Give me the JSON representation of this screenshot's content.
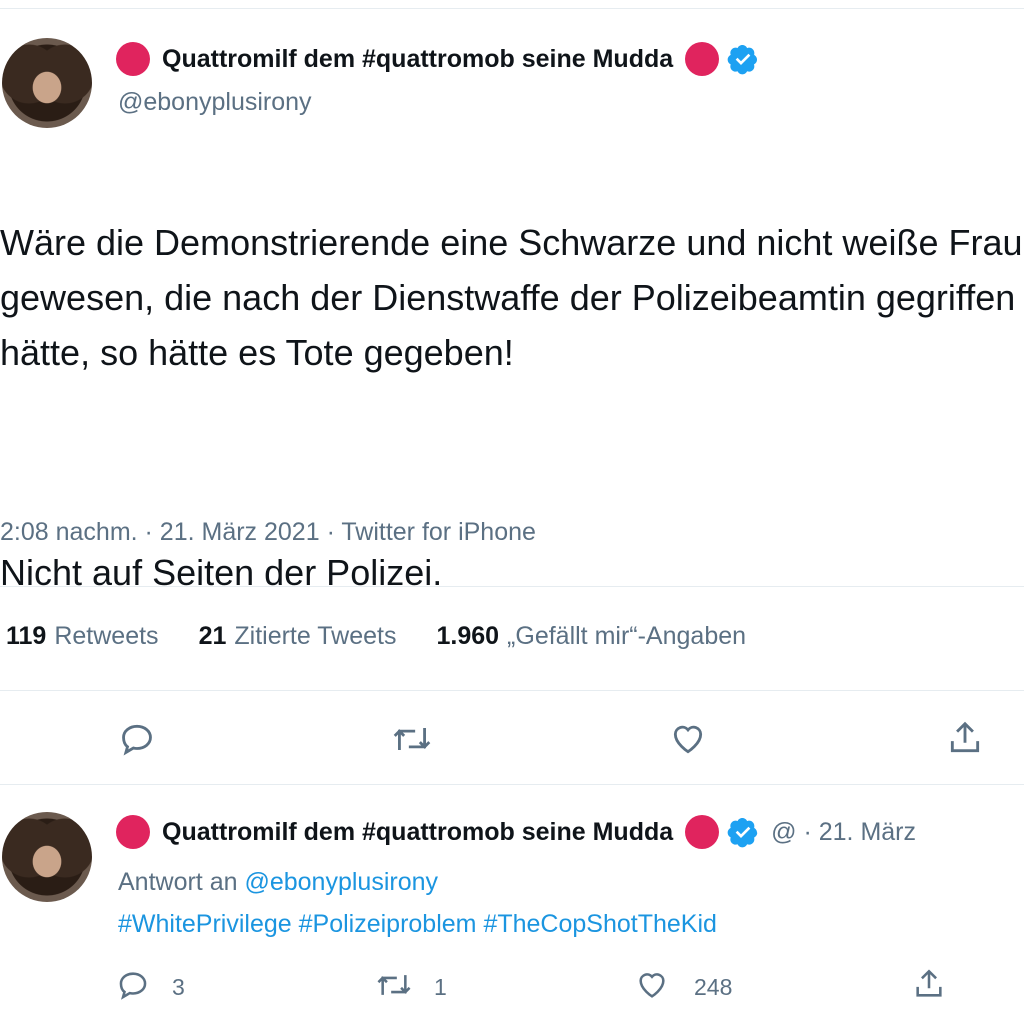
{
  "main_tweet": {
    "display_name": "Quattromilf dem #quattromob seine Mudda",
    "handle": "@ebonyplusirony",
    "text_para1": "Wäre die Demonstrierende eine Schwarze und nicht weiße Frau gewesen, die nach der Dienstwaffe der Polizeibeamtin gegriffen hätte, so hätte es Tote gegeben!",
    "text_para2": "Nicht auf Seiten der Polizei.",
    "timestamp": "2:08 nachm. · 21. März 2021 · Twitter for iPhone",
    "stats": {
      "retweets_count": "119",
      "retweets_label": "Retweets",
      "quotes_count": "21",
      "quotes_label": "Zitierte Tweets",
      "likes_count": "1.960",
      "likes_label": "„Gefällt mir“-Angaben"
    }
  },
  "reply_tweet": {
    "display_name": "Quattromilf dem #quattromob seine Mudda",
    "handle_date": "@ · 21. März",
    "reply_prefix": "Antwort an",
    "reply_to": "@ebonyplusirony",
    "hashtags": "#WhitePrivilege #Polizeiproblem #TheCopShotTheKid",
    "reply_count": "3",
    "retweet_count": "1",
    "like_count": "248"
  },
  "colors": {
    "accent": "#1b95e0",
    "dot": "#e0245e",
    "verified": "#1da1f2"
  },
  "icons": [
    "reply-icon",
    "retweet-icon",
    "like-icon",
    "share-icon",
    "verified-icon"
  ]
}
